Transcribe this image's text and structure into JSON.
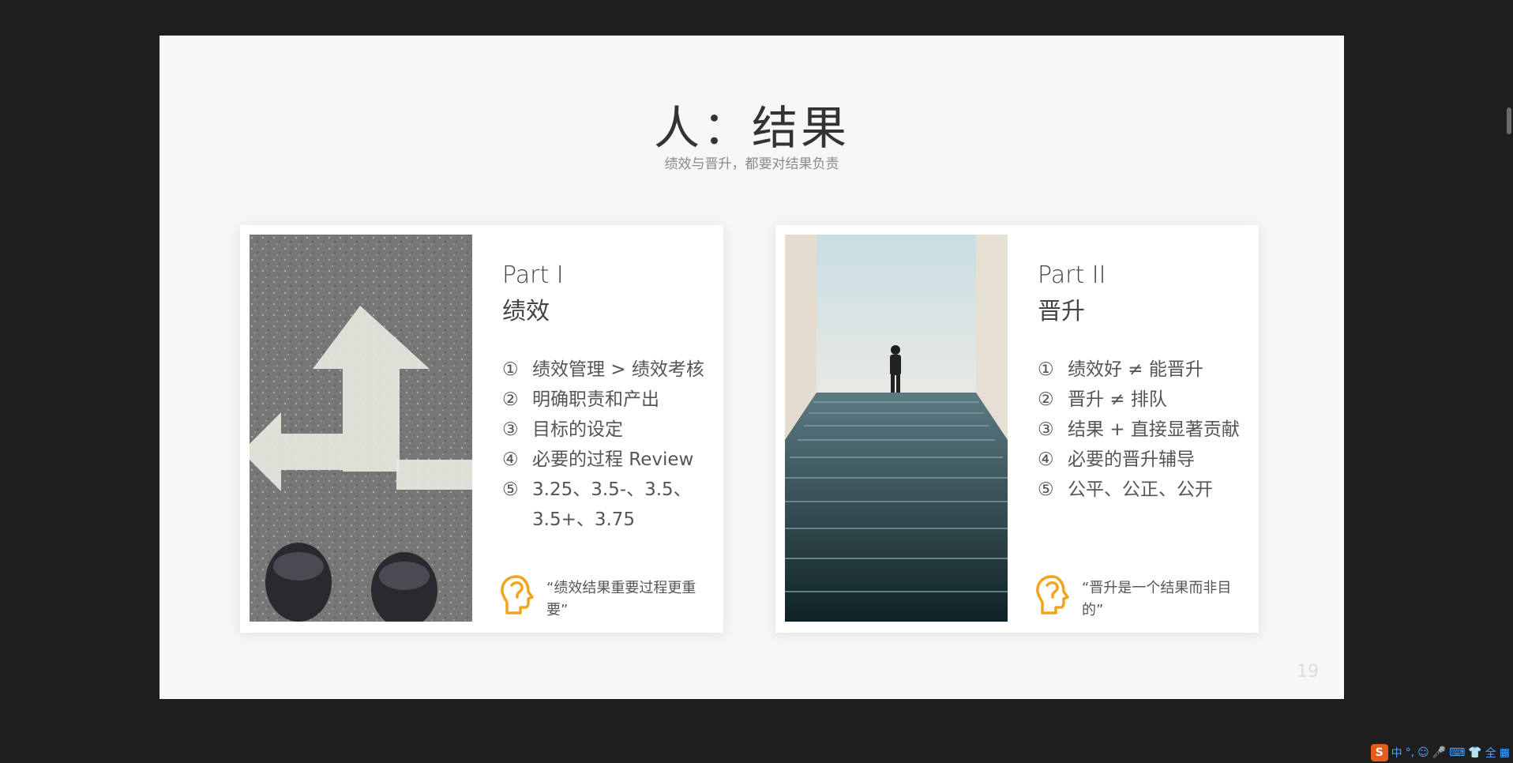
{
  "slide": {
    "title": "人：结果",
    "subtitle": "绩效与晋升，都要对结果负责",
    "page_number": "19"
  },
  "cards": [
    {
      "part": "Part I",
      "title": "绩效",
      "items": [
        {
          "num": "①",
          "text": "绩效管理 > 绩效考核"
        },
        {
          "num": "②",
          "text": "明确职责和产出"
        },
        {
          "num": "③",
          "text": "目标的设定"
        },
        {
          "num": "④",
          "text": "必要的过程 Review"
        },
        {
          "num": "⑤",
          "text": "3.25、3.5-、3.5、3.5+、3.75"
        }
      ],
      "quote": "“绩效结果重要过程更重要”"
    },
    {
      "part": "Part II",
      "title": "晋升",
      "items": [
        {
          "num": "①",
          "text": "绩效好 ≠ 能晋升"
        },
        {
          "num": "②",
          "text": "晋升 ≠  排队"
        },
        {
          "num": "③",
          "text": "结果 + 直接显著贡献"
        },
        {
          "num": "④",
          "text": "必要的晋升辅导"
        },
        {
          "num": "⑤",
          "text": "公平、公正、公开"
        }
      ],
      "quote": "“晋升是一个结果而非目的”"
    }
  ],
  "tray": {
    "ime_logo": "S",
    "ime_mode": "中",
    "punct": "°,",
    "full_width": "全"
  },
  "colors": {
    "accent": "#f2a41c",
    "background": "#1e1e1e",
    "slide": "#f7f7f7"
  }
}
